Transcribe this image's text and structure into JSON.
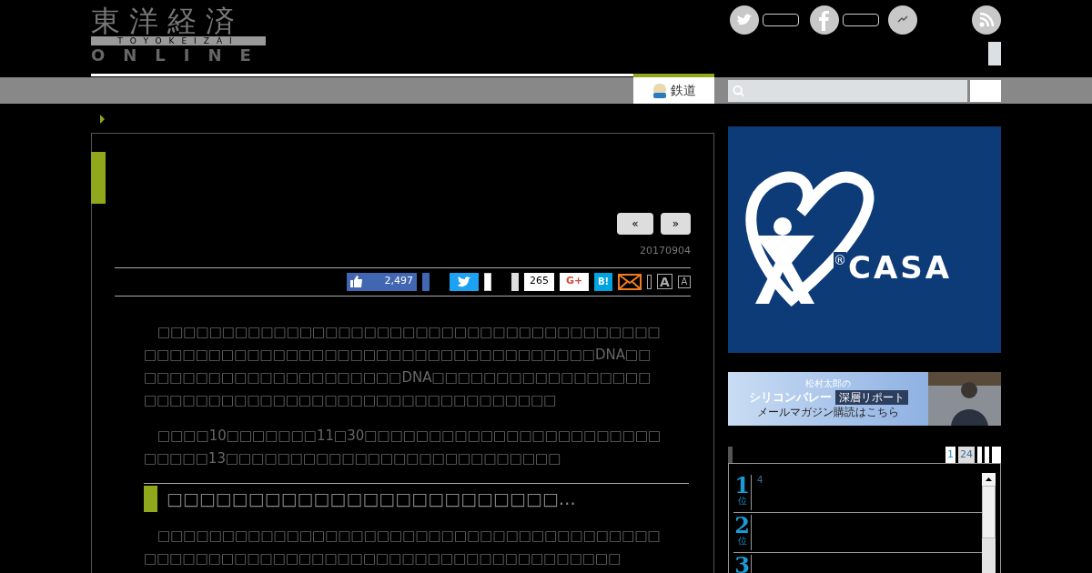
{
  "header": {
    "logo": {
      "kanji": "東洋経済",
      "romaji": "TOYOKEIZAI",
      "online": "ONLINE"
    },
    "nav_tab": {
      "label": "鉄道",
      "selected": true
    }
  },
  "article": {
    "pager": [
      "«",
      "»"
    ],
    "date": "20170904",
    "share": {
      "like_count": "2,497",
      "tweet_count": "265",
      "gplus": "G+",
      "hatena": "B!",
      "font_large": "A",
      "font_small": "A"
    },
    "paragraphs": [
      "　□□□□□□□□□□□□□□□□□□□□□□□□□□□□□□□□□□□□□□□□□□□□□□□□□□□□□□□□□□□□□□□□□□□□□□□□□□DNA□□□□□□□□□□□□□□□□□□□□□□DNA□□□□□□□□□□□□□□□□□□□□□□□□□□□□□□□□□□□□□□□□□□□□□□□□□",
      "　□□□□10□□□□□□□11□30□□□□□□□□□□□□□□□□□□□□□□□□□□□□13□□□□□□□□□□□□□□□□□□□□□□□□□□"
    ],
    "subheading": "□□□□□□□□□□□□□□□□□□□□□□□□…",
    "paragraphs_after": [
      "　□□□□□□□□□□□□□□□□□□□□□□□□□□□□□□□□□□□□□□□□□□□□□□□□□□□□□□□□□□□□□□□□□□□□□□□□□□□□"
    ]
  },
  "sidebar": {
    "ad": {
      "kind": "picture",
      "brand": "CASA",
      "mark": "®"
    },
    "banner": {
      "author": "松村太郎の",
      "title": "シリコンバレー",
      "tag": "深層リポート",
      "cta": "メールマガジン購読はこちら"
    },
    "ranking": {
      "tabs": [
        {
          "label": "1",
          "selected": true
        },
        {
          "label": "24",
          "selected": false
        }
      ],
      "items": [
        {
          "rank": "1",
          "suffix": "位",
          "text": "4"
        },
        {
          "rank": "2",
          "suffix": "位"
        },
        {
          "rank": "3"
        }
      ]
    }
  }
}
